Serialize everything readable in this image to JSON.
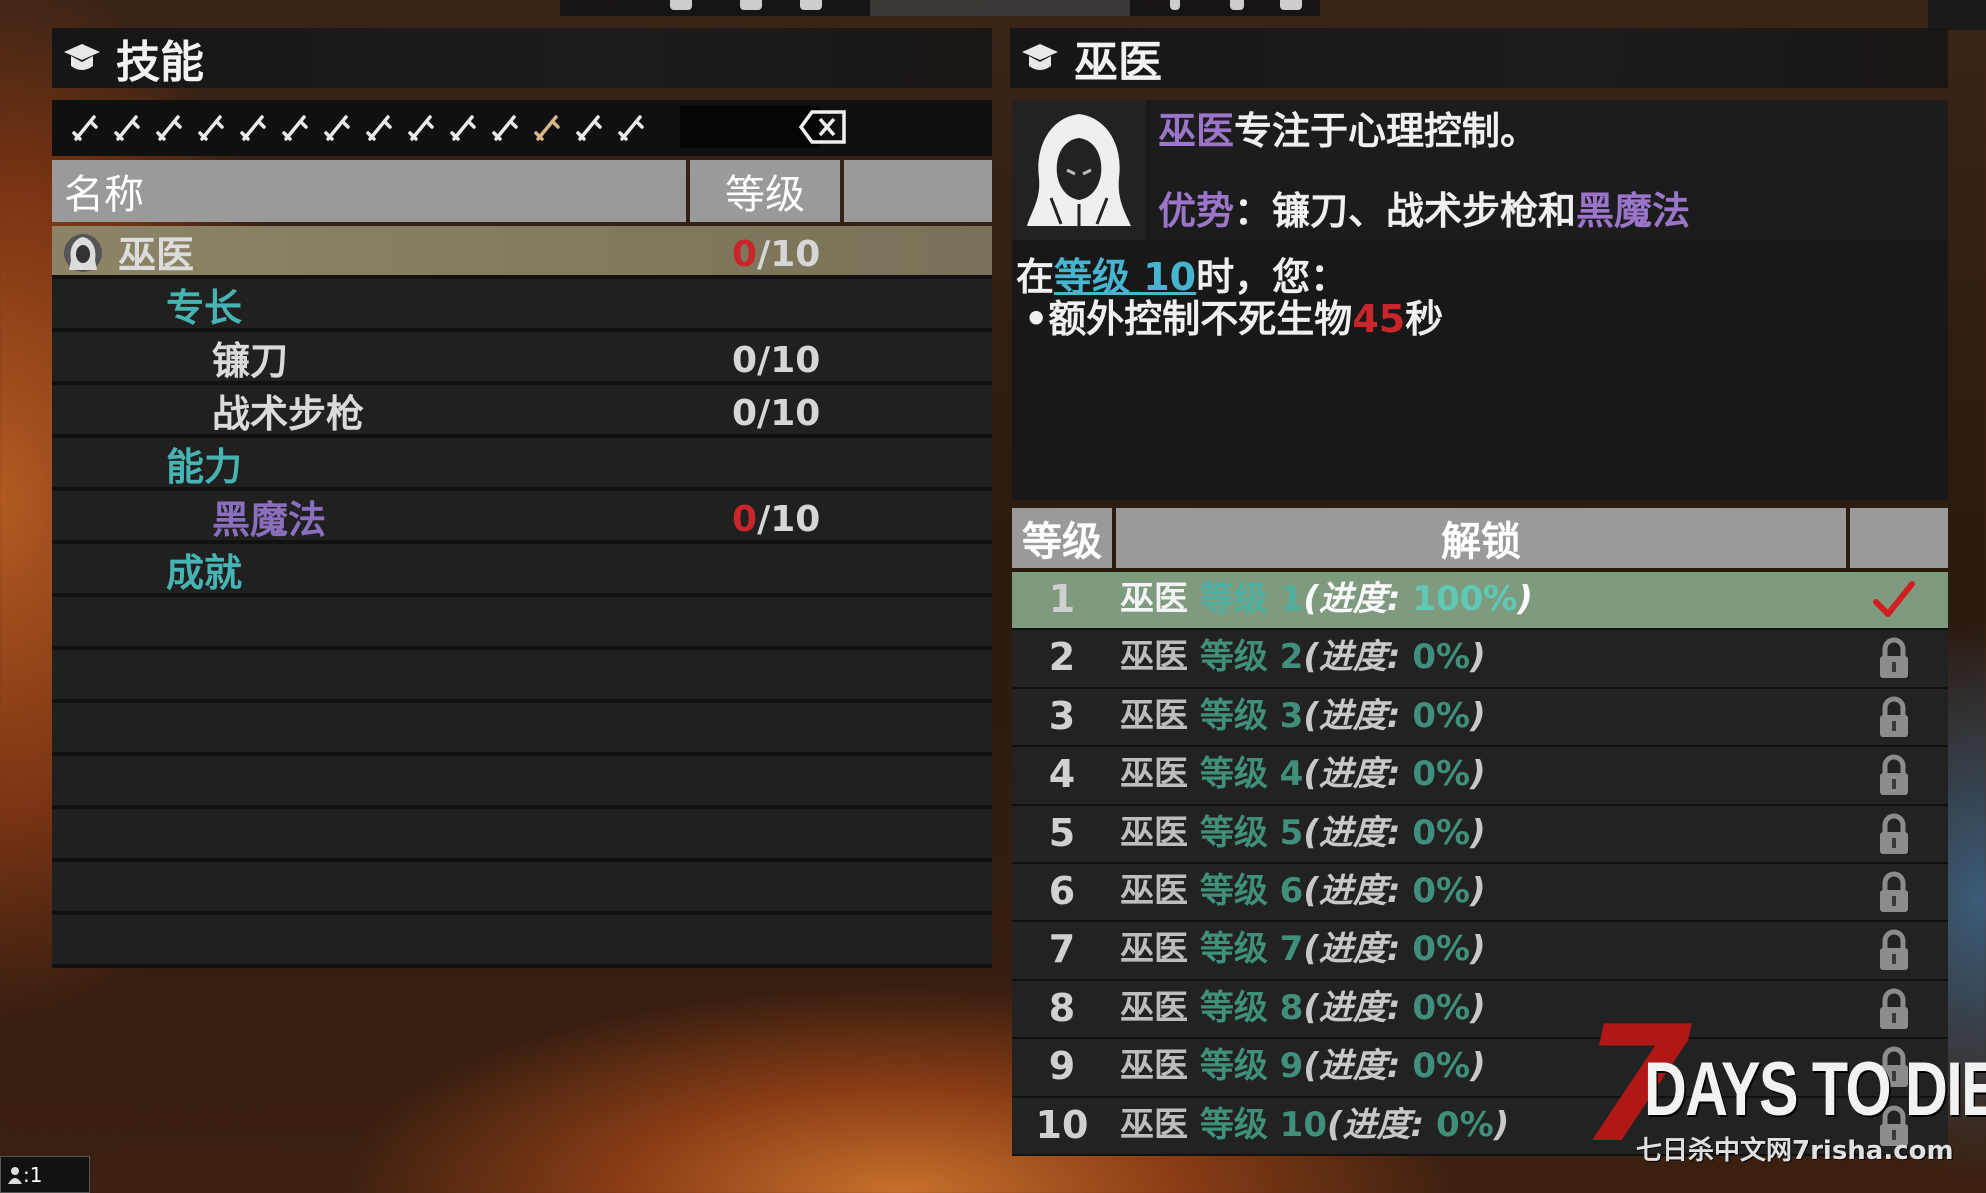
{
  "left": {
    "title": "技能",
    "columns": {
      "name": "名称",
      "level": "等级"
    },
    "rows": [
      {
        "kind": "skill-selected",
        "label": "巫医",
        "cur": "0",
        "max": "/10"
      },
      {
        "kind": "category",
        "label": "专长"
      },
      {
        "kind": "sub",
        "label": "镰刀",
        "level": "0/10"
      },
      {
        "kind": "sub",
        "label": "战术步枪",
        "level": "0/10"
      },
      {
        "kind": "category",
        "label": "能力"
      },
      {
        "kind": "sub-purple",
        "label": "黑魔法",
        "cur": "0",
        "max": "/10"
      },
      {
        "kind": "category",
        "label": "成就"
      }
    ],
    "filter_icons": [
      "needle-icon",
      "hammer-icon",
      "shield-icon",
      "fist-icon",
      "bow-icon",
      "pipe-icon",
      "knife-icon",
      "claw-icon",
      "crossed-swords-icon",
      "wrench-icon",
      "tool-icon",
      "hood-icon",
      "blade-icon",
      "trident-icon"
    ]
  },
  "right": {
    "title": "巫医",
    "desc": {
      "name": "巫医",
      "text": "专注于心理控制。"
    },
    "strength": {
      "label": "优势",
      "sep": "：",
      "items": "镰刀、战术步枪和",
      "magic": "黑魔法"
    },
    "levelinfo": {
      "prefix": "在",
      "link": "等级 10",
      "suffix": "时，您："
    },
    "bullet": {
      "dot": "•",
      "text": "额外控制不死生物",
      "value": "45",
      "unit": "秒"
    },
    "columns": {
      "level": "等级",
      "unlock": "解锁"
    },
    "unlock_rows": [
      {
        "num": "1",
        "name": "巫医",
        "lvl": "等级 1",
        "prog_label": "(进度: ",
        "prog": "100%",
        "close": ")",
        "done": true
      },
      {
        "num": "2",
        "name": "巫医",
        "lvl": "等级 2",
        "prog_label": "(进度: ",
        "prog": "0%",
        "close": ")",
        "done": false
      },
      {
        "num": "3",
        "name": "巫医",
        "lvl": "等级 3",
        "prog_label": "(进度: ",
        "prog": "0%",
        "close": ")",
        "done": false
      },
      {
        "num": "4",
        "name": "巫医",
        "lvl": "等级 4",
        "prog_label": "(进度: ",
        "prog": "0%",
        "close": ")",
        "done": false
      },
      {
        "num": "5",
        "name": "巫医",
        "lvl": "等级 5",
        "prog_label": "(进度: ",
        "prog": "0%",
        "close": ")",
        "done": false
      },
      {
        "num": "6",
        "name": "巫医",
        "lvl": "等级 6",
        "prog_label": "(进度: ",
        "prog": "0%",
        "close": ")",
        "done": false
      },
      {
        "num": "7",
        "name": "巫医",
        "lvl": "等级 7",
        "prog_label": "(进度: ",
        "prog": "0%",
        "close": ")",
        "done": false
      },
      {
        "num": "8",
        "name": "巫医",
        "lvl": "等级 8",
        "prog_label": "(进度: ",
        "prog": "0%",
        "close": ")",
        "done": false
      },
      {
        "num": "9",
        "name": "巫医",
        "lvl": "等级 9",
        "prog_label": "(进度: ",
        "prog": "0%",
        "close": ")",
        "done": false
      },
      {
        "num": "10",
        "name": "巫医",
        "lvl": "等级 10",
        "prog_label": "(进度: ",
        "prog": "0%",
        "close": ")",
        "done": false
      }
    ]
  },
  "watermark": {
    "big": "7",
    "days": "DAYS TO DIE",
    "sub": "七日杀中文网7risha.com"
  },
  "badge": ":1",
  "colors": {
    "category": "#47b4b4",
    "purple": "#9a75c9",
    "red": "#c8262a",
    "done_row": "#7f9b7f"
  }
}
